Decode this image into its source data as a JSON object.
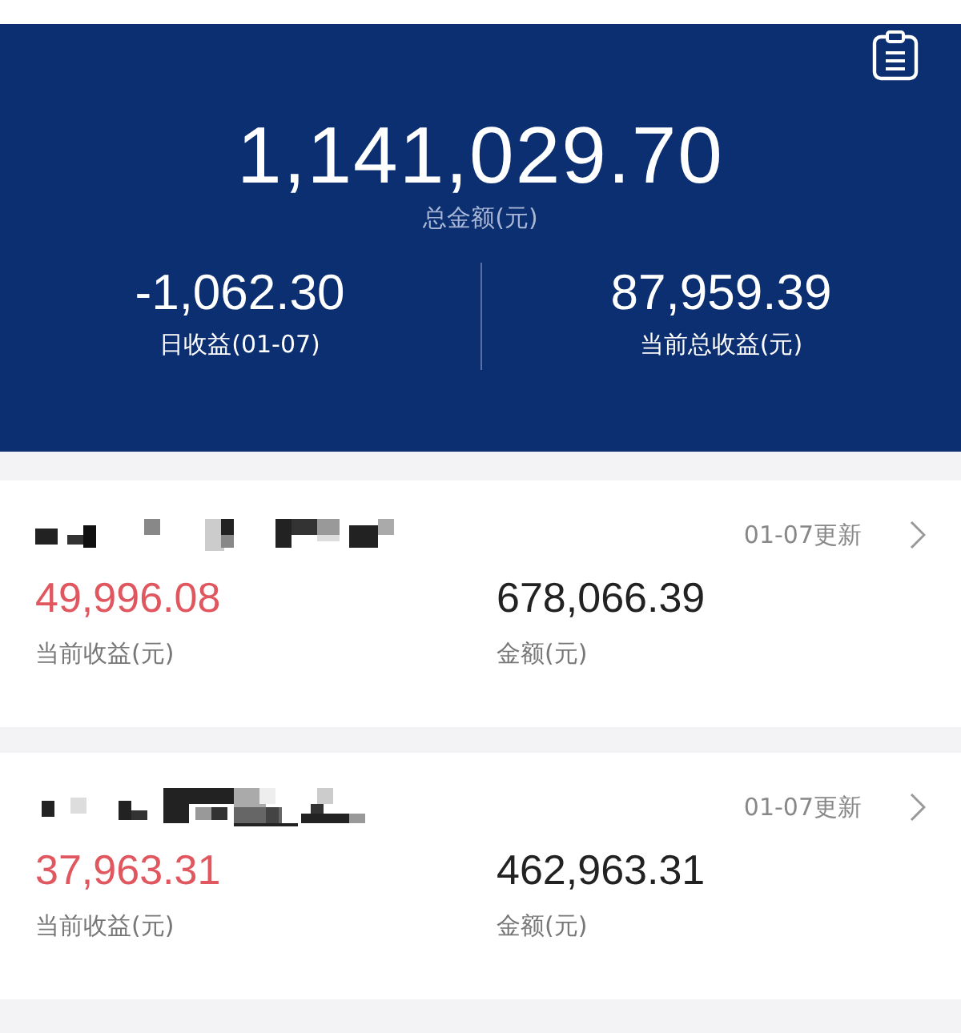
{
  "summary": {
    "total": "1,141,029.70",
    "total_label": "总金额(元)",
    "stats": [
      {
        "value": "-1,062.30",
        "label": "日收益(01-07)"
      },
      {
        "value": "87,959.39",
        "label": "当前总收益(元)"
      }
    ]
  },
  "holdings": [
    {
      "updated": "01-07更新",
      "profit": "49,996.08",
      "profit_label": "当前收益(元)",
      "amount": "678,066.39",
      "amount_label": "金额(元)"
    },
    {
      "updated": "01-07更新",
      "profit": "37,963.31",
      "profit_label": "当前收益(元)",
      "amount": "462,963.31",
      "amount_label": "金额(元)"
    }
  ]
}
